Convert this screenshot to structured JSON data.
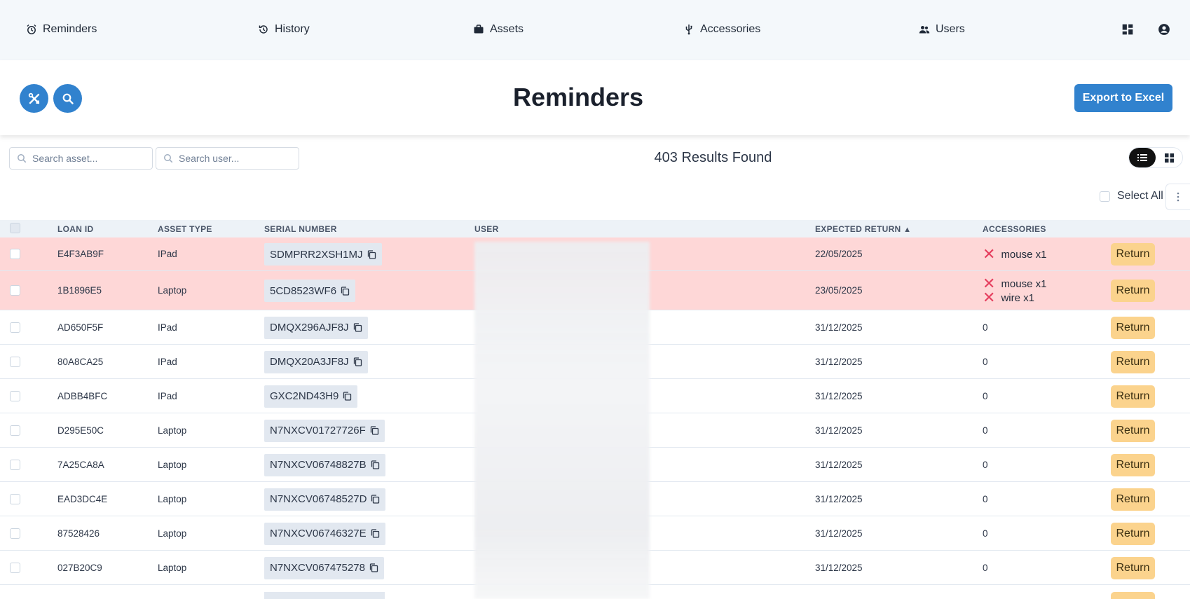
{
  "nav": {
    "items": [
      {
        "label": "Reminders",
        "icon": "alarm-clock-icon"
      },
      {
        "label": "History",
        "icon": "history-icon"
      },
      {
        "label": "Assets",
        "icon": "briefcase-icon"
      },
      {
        "label": "Accessories",
        "icon": "usb-icon"
      },
      {
        "label": "Users",
        "icon": "users-icon"
      }
    ],
    "right_icons": [
      "dashboard-icon",
      "account-icon"
    ]
  },
  "header": {
    "title": "Reminders",
    "export_label": "Export to Excel",
    "left_buttons": [
      "tools-icon",
      "search-icon"
    ]
  },
  "toolbar": {
    "search_asset_placeholder": "Search asset...",
    "search_user_placeholder": "Search user...",
    "results_text": "403 Results Found",
    "select_all_label": "Select All",
    "view_modes": [
      "list-view-icon",
      "grid-view-icon"
    ],
    "active_view": "list"
  },
  "table": {
    "headers": {
      "loan_id": "LOAN ID",
      "asset_type": "ASSET TYPE",
      "serial_number": "SERIAL NUMBER",
      "user": "USER",
      "expected_return": "EXPECTED RETURN",
      "accessories": "ACCESSORIES"
    },
    "sort_indicator": "▲",
    "return_label": "Return",
    "rows": [
      {
        "loan_id": "E4F3AB9F",
        "asset_type": "IPad",
        "serial": "SDMPRR2XSH1MJ",
        "expected_return": "22/05/2025",
        "accessories": [
          "mouse x1"
        ],
        "overdue": true
      },
      {
        "loan_id": "1B1896E5",
        "asset_type": "Laptop",
        "serial": "5CD8523WF6",
        "expected_return": "23/05/2025",
        "accessories": [
          "mouse x1",
          "wire x1"
        ],
        "overdue": true
      },
      {
        "loan_id": "AD650F5F",
        "asset_type": "IPad",
        "serial": "DMQX296AJF8J",
        "expected_return": "31/12/2025",
        "accessories_count": "0",
        "overdue": false
      },
      {
        "loan_id": "80A8CA25",
        "asset_type": "IPad",
        "serial": "DMQX20A3JF8J",
        "expected_return": "31/12/2025",
        "accessories_count": "0",
        "overdue": false
      },
      {
        "loan_id": "ADBB4BFC",
        "asset_type": "IPad",
        "serial": "GXC2ND43H9",
        "expected_return": "31/12/2025",
        "accessories_count": "0",
        "overdue": false
      },
      {
        "loan_id": "D295E50C",
        "asset_type": "Laptop",
        "serial": "N7NXCV01727726F",
        "expected_return": "31/12/2025",
        "accessories_count": "0",
        "overdue": false
      },
      {
        "loan_id": "7A25CA8A",
        "asset_type": "Laptop",
        "serial": "N7NXCV06748827B",
        "expected_return": "31/12/2025",
        "accessories_count": "0",
        "overdue": false
      },
      {
        "loan_id": "EAD3DC4E",
        "asset_type": "Laptop",
        "serial": "N7NXCV06748527D",
        "expected_return": "31/12/2025",
        "accessories_count": "0",
        "overdue": false
      },
      {
        "loan_id": "87528426",
        "asset_type": "Laptop",
        "serial": "N7NXCV06746327E",
        "expected_return": "31/12/2025",
        "accessories_count": "0",
        "overdue": false
      },
      {
        "loan_id": "027B20C9",
        "asset_type": "Laptop",
        "serial": "N7NXCV067475278",
        "expected_return": "31/12/2025",
        "accessories_count": "0",
        "overdue": false
      }
    ]
  },
  "colors": {
    "primary": "#3182ce",
    "overdue_row": "#fed7d7",
    "return_button": "#fbd38d",
    "accessory_missing": "#e53e5e"
  }
}
